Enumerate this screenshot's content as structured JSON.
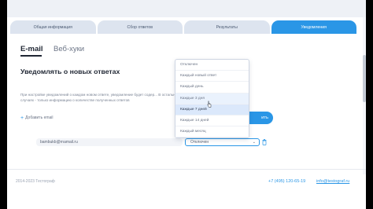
{
  "tabs": [
    {
      "label": "Общая информация",
      "active": false
    },
    {
      "label": "Сбор ответов",
      "active": false
    },
    {
      "label": "Результаты",
      "active": false
    },
    {
      "label": "Уведомления",
      "active": true
    }
  ],
  "subtabs": {
    "email": "E-mail",
    "web": "Веб-хуки"
  },
  "heading": "Уведомлять о новых ответах",
  "note": "При настройке уведомлений о каждом новом ответе, уведомление будет содер... В остальных случаях - только информацию о количестве полученных ответов",
  "add_email_label": "Добавить email",
  "action_button_label": "ить",
  "email_value": "bambukb@rnamail.ru",
  "select": {
    "value": "Отключен"
  },
  "dropdown_options": [
    "Отключен",
    "Каждый новый ответ",
    "Каждый день",
    "Каждые 3 дня",
    "Каждые 7 дней",
    "Каждые 14 дней",
    "Каждый месяц"
  ],
  "highlighted_option_index": 4,
  "hover_option_index": 3,
  "footer": {
    "copyright": "2014-2023 Тестограф",
    "phone": "+7 (495) 120-65-19",
    "email": "info@testograf.ru"
  },
  "colors": {
    "accent": "#2a96e6"
  },
  "icons": {
    "trash": "trash-icon",
    "chevron": "chevron-down-icon",
    "cursor": "mouse-cursor-icon"
  }
}
